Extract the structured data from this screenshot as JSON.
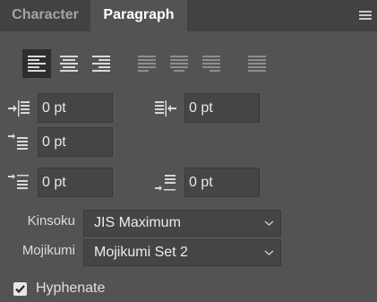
{
  "tabs": [
    {
      "label": "Character",
      "active": false
    },
    {
      "label": "Paragraph",
      "active": true
    }
  ],
  "panel_menu_icon": "hamburger-menu-icon",
  "alignment": {
    "buttons": [
      {
        "name": "align-left",
        "selected": true
      },
      {
        "name": "align-center",
        "selected": false
      },
      {
        "name": "align-right",
        "selected": false
      },
      {
        "name": "justify-last-left",
        "selected": false
      },
      {
        "name": "justify-last-center",
        "selected": false
      },
      {
        "name": "justify-last-right",
        "selected": false
      },
      {
        "name": "justify-all",
        "selected": false
      }
    ]
  },
  "indents": {
    "left_indent": "0 pt",
    "right_indent": "0 pt",
    "first_line_indent": "0 pt",
    "space_before": "0 pt",
    "space_after": "0 pt"
  },
  "kinsoku": {
    "label": "Kinsoku",
    "value": "JIS Maximum"
  },
  "mojikumi": {
    "label": "Mojikumi",
    "value": "Mojikumi Set 2"
  },
  "hyphenate": {
    "label": "Hyphenate",
    "checked": true
  },
  "colors": {
    "panel_bg": "#535353",
    "tabbar_bg": "#424242",
    "field_bg": "#454545",
    "selected_btn_bg": "#2e2e2e"
  }
}
